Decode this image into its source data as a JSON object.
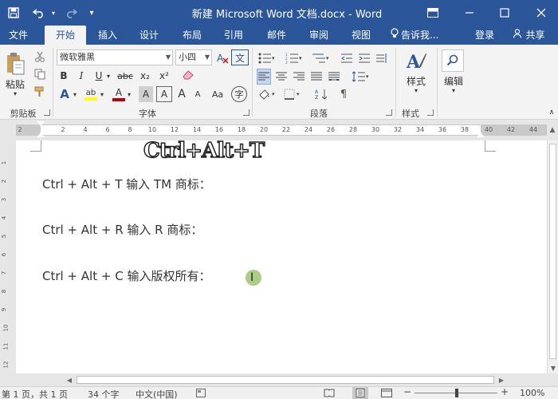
{
  "titlebar": {
    "document_title": "新建 Microsoft Word 文档.docx - Word",
    "quick_access": [
      "save-icon",
      "undo-icon",
      "redo-icon",
      "customize-icon"
    ],
    "window_controls": [
      "ribbon-display-icon",
      "minimize-icon",
      "maximize-icon",
      "close-icon"
    ]
  },
  "tabs": {
    "items": [
      "文件",
      "开始",
      "插入",
      "设计",
      "布局",
      "引用",
      "邮件",
      "审阅",
      "视图"
    ],
    "active": "开始",
    "tell_me": "告诉我...",
    "signin": "登录",
    "share": "共享"
  },
  "ribbon": {
    "clipboard": {
      "label": "剪贴板",
      "paste": "粘贴"
    },
    "font": {
      "label": "字体",
      "font_name": "微软雅黑",
      "font_size": "小四",
      "bold": "B",
      "italic": "I",
      "underline": "U",
      "strike": "abc",
      "subscript": "x₂",
      "superscript": "x²",
      "grow": "A",
      "shrink": "A",
      "case": "Aa",
      "phonetic": "文",
      "enclose": "字",
      "effects": "A",
      "highlight": "ab",
      "font_color": "A",
      "shading": "A"
    },
    "paragraph": {
      "label": "段落"
    },
    "styles": {
      "label": "样式",
      "button": "样式"
    },
    "editing": {
      "button": "编辑"
    }
  },
  "ruler": {
    "numbers": [
      "2",
      "2",
      "4",
      "6",
      "8",
      "10",
      "12",
      "14",
      "16",
      "18",
      "20",
      "22",
      "24",
      "26",
      "28",
      "30",
      "32",
      "34",
      "36",
      "38",
      "40",
      "42",
      "44"
    ]
  },
  "vertical_ruler": {
    "numbers": [
      "1",
      "2",
      "3",
      "4",
      "5",
      "6",
      "7",
      "8",
      "9",
      "10",
      "11",
      "12"
    ]
  },
  "document": {
    "banner": "Ctrl+Alt+T",
    "lines": [
      "Ctrl + Alt + T  输入 TM 商标：",
      "Ctrl + Alt + R 输入 R 商标：",
      "Ctrl + Alt + C 输入版权所有："
    ]
  },
  "status": {
    "page": "第 1 页，共 1 页",
    "words": "34 个字",
    "language": "中文(中国)",
    "zoom": "100%"
  },
  "colors": {
    "brand": "#2b579a",
    "highlight": "#ffff00",
    "font_color": "#c00000",
    "cursor_dot": "#8ebe60"
  }
}
